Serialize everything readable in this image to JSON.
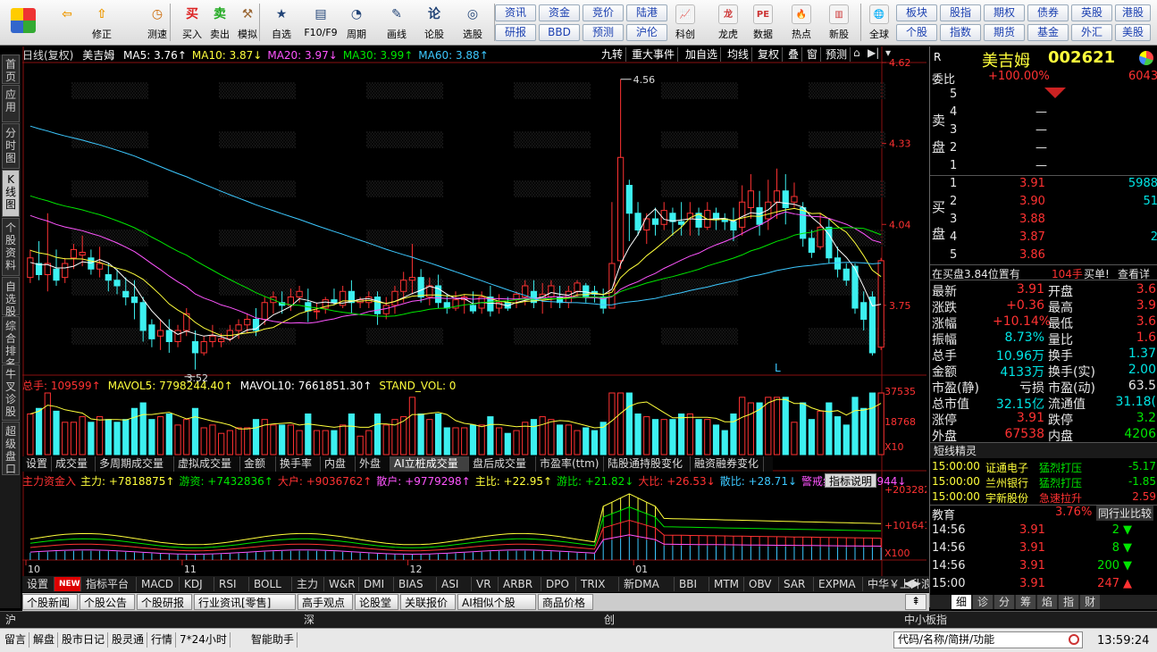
{
  "toolbar": {
    "left": [
      {
        "label": "",
        "icon": "grid-icon"
      },
      {
        "label": "",
        "icon": "back-arrow-icon"
      },
      {
        "label": "修正",
        "icon": "correct-icon"
      },
      {
        "label": "测速",
        "icon": "clock-icon"
      },
      {
        "label": "买入",
        "icon": "buy-icon"
      },
      {
        "label": "卖出",
        "icon": "sell-icon"
      },
      {
        "label": "模拟",
        "icon": "hammer-icon"
      },
      {
        "label": "自选",
        "icon": "star-icon"
      },
      {
        "label": "F10/F9",
        "icon": "f10-icon"
      },
      {
        "label": "周期",
        "icon": "period-icon"
      },
      {
        "label": "画线",
        "icon": "pen-icon"
      },
      {
        "label": "论股",
        "icon": "discuss-icon"
      },
      {
        "label": "选股",
        "icon": "select-stock-icon"
      }
    ],
    "mid_buttons": [
      [
        "资讯",
        "资金",
        "竞价",
        "陆港"
      ],
      [
        "研报",
        "BBD",
        "预测",
        "沪伦"
      ]
    ],
    "mid_icons": [
      {
        "label": "科创",
        "icon": "kechuang-icon"
      },
      {
        "label": "龙虎",
        "icon": "dragon-icon"
      },
      {
        "label": "数据",
        "icon": "pe-icon"
      },
      {
        "label": "热点",
        "icon": "hot-icon"
      },
      {
        "label": "新股",
        "icon": "newstock-icon"
      },
      {
        "label": "全球",
        "icon": "globe-icon"
      }
    ],
    "right_buttons": [
      [
        "板块",
        "股指",
        "期权",
        "债券",
        "英股",
        "港股"
      ],
      [
        "个股",
        "指数",
        "期货",
        "基金",
        "外汇",
        "美股"
      ]
    ]
  },
  "side_tabs": [
    "首页",
    "应用",
    "分时图",
    "K线图",
    "个股资料",
    "自选股",
    "综合排名",
    "牛叉诊股",
    "超级盘口"
  ],
  "chart_header": {
    "title": "日线(复权)",
    "name": "美吉姆",
    "ma": [
      {
        "label": "MA5: 3.76↑",
        "color": "#ffffff"
      },
      {
        "label": "MA10: 3.87↓",
        "color": "#ffff3c"
      },
      {
        "label": "MA20: 3.97↓",
        "color": "#ff55ff"
      },
      {
        "label": "MA30: 3.99↑",
        "color": "#00e600"
      },
      {
        "label": "MA60: 3.88↑",
        "color": "#3cc8ff"
      }
    ],
    "buttons": [
      "九转",
      "重大事件",
      "加自选",
      "均线",
      "复权",
      "叠",
      "窗",
      "预测"
    ]
  },
  "y_axis_main": [
    "4.62",
    "4.33",
    "4.04",
    "3.75"
  ],
  "annotations": {
    "high": "4.56",
    "low": "3.52",
    "marker": "L"
  },
  "vol_header": [
    {
      "label": "总手: 109599↑",
      "color": "#ff3232"
    },
    {
      "label": "MAVOL5: 7798244.40↑",
      "color": "#ffff3c"
    },
    {
      "label": "MAVOL10: 7661851.30↑",
      "color": "#ffffff"
    },
    {
      "label": "STAND_VOL: 0",
      "color": "#ffff3c"
    }
  ],
  "y_axis_vol": [
    "37535",
    "18768",
    "X10"
  ],
  "indicator_tabs": [
    "设置",
    "成交量",
    "多周期成交量",
    "虚拟成交量",
    "金额",
    "换手率",
    "内盘",
    "外盘",
    "AI立桩成交量",
    "盘后成交量",
    "市盈率(ttm)",
    "陆股通持股变化",
    "融资融券变化"
  ],
  "indicator_active": "AI立桩成交量",
  "fund_header": [
    {
      "label": "主力资金入",
      "color": "#ff3232"
    },
    {
      "label": "主力: +7818875↑",
      "color": "#ffff3c"
    },
    {
      "label": "游资: +7432836↑",
      "color": "#00e600"
    },
    {
      "label": "大户: +9036762↑",
      "color": "#ff3232"
    },
    {
      "label": "散户: +9779298↑",
      "color": "#ff55ff"
    },
    {
      "label": "主比: +22.95↑",
      "color": "#ffff3c"
    },
    {
      "label": "游比: +21.82↓",
      "color": "#00e600"
    },
    {
      "label": "大比: +26.53↓",
      "color": "#ff3232"
    },
    {
      "label": "散比: +28.71↓",
      "color": "#3cc8ff"
    },
    {
      "label": "警戒线: +5716944↓",
      "color": "#ff55ff"
    }
  ],
  "indicator_help": "指标说明",
  "y_axis_fund": [
    "+203282",
    "+101641",
    "X100"
  ],
  "x_axis": [
    "10",
    "11",
    "12",
    "01"
  ],
  "bottom_tabs": [
    "设置",
    "NEW",
    "指标平台",
    "MACD",
    "KDJ",
    "RSI",
    "BOLL",
    "主力",
    "W&R",
    "DMI",
    "BIAS",
    "ASI",
    "VR",
    "ARBR",
    "DPO",
    "TRIX",
    "新DMA",
    "BBI",
    "MTM",
    "OBV",
    "SAR",
    "EXPMA",
    "中华￥上升浪"
  ],
  "news_tabs": [
    "个股新闻",
    "个股公告",
    "个股研报",
    "行业资讯[零售]",
    "高手观点",
    "论股堂",
    "关联报价",
    "AI相似个股",
    "商品价格"
  ],
  "quote": {
    "tag": "R",
    "name": "美吉姆",
    "code": "002621",
    "weibi_label": "委比",
    "weibi": "+100.00%",
    "weicha": "6043",
    "sell_label": "卖盘",
    "buy_label": "买盘",
    "sell": [
      [
        "5",
        "",
        ""
      ],
      [
        "4",
        "—",
        ""
      ],
      [
        "3",
        "—",
        ""
      ],
      [
        "2",
        "—",
        ""
      ],
      [
        "1",
        "—",
        ""
      ]
    ],
    "buy": [
      [
        "1",
        "3.91",
        "5988"
      ],
      [
        "2",
        "3.90",
        "51"
      ],
      [
        "3",
        "3.88",
        ""
      ],
      [
        "4",
        "3.87",
        "2"
      ],
      [
        "5",
        "3.86",
        ""
      ]
    ],
    "bid_note": "在买盘3.84位置有",
    "bid_qty": "104手",
    "bid_type": "买单!",
    "bid_link": "查看详",
    "stats": [
      [
        "最新",
        "3.91",
        "red",
        "开盘",
        "3.6",
        "red"
      ],
      [
        "涨跌",
        "+0.36",
        "red",
        "最高",
        "3.9",
        "red"
      ],
      [
        "涨幅",
        "+10.14%",
        "red",
        "最低",
        "3.6",
        "red"
      ],
      [
        "振幅",
        "8.73%",
        "cyan",
        "量比",
        "1.6",
        "red"
      ],
      [
        "总手",
        "10.96万",
        "cyan",
        "换手",
        "1.37",
        "cyan"
      ],
      [
        "金额",
        "4133万",
        "cyan",
        "换手(实)",
        "2.00",
        "cyan"
      ],
      [
        "市盈(静)",
        "亏损",
        "wht",
        "市盈(动)",
        "63.5",
        "wht"
      ],
      [
        "总市值",
        "32.15亿",
        "cyan",
        "流通值",
        "31.18(",
        "cyan"
      ],
      [
        "涨停",
        "3.91",
        "red",
        "跌停",
        "3.2",
        "grn"
      ],
      [
        "外盘",
        "67538",
        "red",
        "内盘",
        "4206",
        "grn"
      ]
    ],
    "short_title": "短线精灵",
    "short": [
      [
        "15:00:00",
        "证通电子",
        "猛烈打压",
        "-5.17"
      ],
      [
        "15:00:00",
        "兰州银行",
        "猛烈打压",
        "-1.85"
      ],
      [
        "15:00:00",
        "宇新股份",
        "急速拉升",
        "2.59"
      ]
    ],
    "sector": "教育",
    "sector_pct": "3.76%",
    "sector_link": "同行业比较",
    "ticks": [
      [
        "14:56",
        "3.91",
        "2",
        "down"
      ],
      [
        "14:56",
        "3.91",
        "8",
        "down"
      ],
      [
        "14:56",
        "3.91",
        "200",
        "down"
      ],
      [
        "15:00",
        "3.91",
        "247",
        "up"
      ]
    ],
    "detail_tabs": [
      "细",
      "诊",
      "分",
      "筹",
      "焰",
      "指",
      "财"
    ]
  },
  "market": {
    "sh": "沪",
    "sz": "深",
    "cy": "创",
    "zx": "中小板指"
  },
  "status": {
    "items": [
      "留言",
      "解盘",
      "股市日记",
      "股灵通",
      "行情",
      "7*24小时",
      "智能助手"
    ],
    "search_placeholder": "代码/名称/简拼/功能",
    "time": "13:59:24"
  },
  "chart_data": {
    "type": "candlestick",
    "ylim": [
      3.5,
      4.62
    ],
    "candles": [
      [
        3.85,
        3.92,
        3.95,
        3.83
      ],
      [
        3.9,
        3.86,
        3.98,
        3.84
      ],
      [
        3.86,
        3.9,
        4.08,
        3.8
      ],
      [
        3.88,
        3.84,
        3.95,
        3.82
      ],
      [
        3.85,
        3.9,
        3.92,
        3.83
      ],
      [
        3.92,
        3.95,
        3.97,
        3.88
      ],
      [
        3.93,
        3.94,
        4.0,
        3.89
      ],
      [
        3.92,
        3.88,
        3.95,
        3.86
      ],
      [
        3.88,
        3.9,
        3.96,
        3.85
      ],
      [
        3.86,
        3.84,
        3.9,
        3.8
      ],
      [
        3.84,
        3.82,
        3.88,
        3.79
      ],
      [
        3.8,
        3.78,
        3.85,
        3.75
      ],
      [
        3.78,
        3.76,
        3.84,
        3.7
      ],
      [
        3.76,
        3.66,
        3.78,
        3.62
      ],
      [
        3.68,
        3.63,
        3.7,
        3.6
      ],
      [
        3.64,
        3.66,
        3.7,
        3.59
      ],
      [
        3.66,
        3.62,
        3.7,
        3.58
      ],
      [
        3.62,
        3.66,
        3.68,
        3.6
      ],
      [
        3.66,
        3.72,
        3.74,
        3.64
      ],
      [
        3.62,
        3.58,
        3.66,
        3.52
      ],
      [
        3.58,
        3.62,
        3.64,
        3.57
      ],
      [
        3.62,
        3.64,
        3.68,
        3.6
      ],
      [
        3.62,
        3.63,
        3.65,
        3.6
      ],
      [
        3.63,
        3.66,
        3.68,
        3.62
      ],
      [
        3.66,
        3.68,
        3.7,
        3.63
      ],
      [
        3.68,
        3.7,
        3.72,
        3.65
      ],
      [
        3.7,
        3.66,
        3.74,
        3.64
      ],
      [
        3.7,
        3.76,
        3.78,
        3.68
      ],
      [
        3.76,
        3.78,
        3.8,
        3.72
      ],
      [
        3.76,
        3.75,
        3.8,
        3.72
      ],
      [
        3.75,
        3.78,
        3.81,
        3.73
      ],
      [
        3.78,
        3.8,
        3.82,
        3.76
      ],
      [
        3.76,
        3.73,
        3.81,
        3.69
      ],
      [
        3.73,
        3.73,
        3.76,
        3.7
      ],
      [
        3.74,
        3.77,
        3.78,
        3.72
      ],
      [
        3.77,
        3.76,
        3.81,
        3.75
      ],
      [
        3.75,
        3.8,
        3.82,
        3.74
      ],
      [
        3.8,
        3.76,
        3.84,
        3.72
      ],
      [
        3.76,
        3.77,
        3.78,
        3.74
      ],
      [
        3.76,
        3.78,
        3.8,
        3.74
      ],
      [
        3.78,
        3.72,
        3.8,
        3.68
      ],
      [
        3.72,
        3.75,
        3.78,
        3.7
      ],
      [
        3.75,
        3.8,
        3.82,
        3.72
      ],
      [
        3.8,
        3.84,
        3.87,
        3.76
      ],
      [
        3.84,
        3.85,
        3.97,
        3.79
      ],
      [
        3.85,
        3.78,
        3.88,
        3.76
      ],
      [
        3.78,
        3.82,
        3.85,
        3.75
      ],
      [
        3.82,
        3.76,
        3.86,
        3.74
      ],
      [
        3.76,
        3.74,
        3.79,
        3.72
      ],
      [
        3.74,
        3.77,
        3.8,
        3.73
      ],
      [
        3.77,
        3.78,
        3.79,
        3.72
      ],
      [
        3.75,
        3.73,
        3.8,
        3.72
      ],
      [
        3.74,
        3.78,
        3.8,
        3.72
      ],
      [
        3.78,
        3.73,
        3.82,
        3.71
      ],
      [
        3.74,
        3.76,
        3.79,
        3.72
      ],
      [
        3.76,
        3.74,
        3.78,
        3.73
      ],
      [
        3.77,
        3.79,
        3.8,
        3.74
      ],
      [
        3.78,
        3.82,
        3.84,
        3.75
      ],
      [
        3.8,
        3.76,
        3.84,
        3.74
      ],
      [
        3.77,
        3.79,
        3.83,
        3.72
      ],
      [
        3.78,
        3.82,
        3.84,
        3.74
      ],
      [
        3.78,
        3.76,
        3.82,
        3.74
      ],
      [
        3.76,
        3.8,
        3.82,
        3.74
      ],
      [
        3.8,
        3.83,
        3.84,
        3.78
      ],
      [
        3.82,
        3.78,
        3.83,
        3.76
      ],
      [
        3.8,
        3.79,
        3.82,
        3.76
      ],
      [
        3.78,
        3.74,
        3.81,
        3.72
      ],
      [
        3.74,
        3.9,
        4.12,
        3.74
      ],
      [
        3.91,
        4.28,
        4.56,
        3.88
      ],
      [
        4.18,
        4.08,
        4.2,
        3.98
      ],
      [
        4.08,
        4.02,
        4.12,
        4.0
      ],
      [
        4.02,
        4.06,
        4.08,
        3.97
      ],
      [
        4.06,
        4.04,
        4.1,
        4.0
      ],
      [
        4.04,
        4.09,
        4.12,
        4.02
      ],
      [
        4.08,
        4.05,
        4.1,
        4.0
      ],
      [
        4.05,
        4.04,
        4.12,
        4.0
      ],
      [
        4.06,
        4.08,
        4.12,
        4.0
      ],
      [
        4.08,
        4.03,
        4.1,
        4.0
      ],
      [
        4.03,
        4.09,
        4.12,
        4.02
      ],
      [
        4.08,
        4.06,
        4.1,
        4.02
      ],
      [
        4.06,
        4.05,
        4.08,
        4.02
      ],
      [
        4.05,
        4.02,
        4.1,
        3.98
      ],
      [
        4.03,
        4.12,
        4.18,
        4.0
      ],
      [
        4.1,
        4.16,
        4.22,
        4.06
      ],
      [
        4.1,
        4.04,
        4.16,
        4.0
      ],
      [
        4.06,
        4.12,
        4.2,
        4.02
      ],
      [
        4.12,
        4.16,
        4.24,
        4.06
      ],
      [
        4.16,
        4.1,
        4.22,
        4.04
      ],
      [
        4.12,
        4.14,
        4.19,
        4.1
      ],
      [
        4.1,
        3.99,
        4.12,
        3.96
      ],
      [
        3.99,
        3.94,
        4.02,
        3.92
      ],
      [
        3.96,
        4.03,
        4.08,
        3.95
      ],
      [
        4.03,
        3.92,
        4.06,
        3.9
      ],
      [
        3.92,
        3.88,
        3.96,
        3.85
      ],
      [
        3.88,
        3.84,
        3.9,
        3.82
      ],
      [
        3.89,
        3.74,
        3.9,
        3.72
      ],
      [
        3.76,
        3.7,
        3.8,
        3.66
      ],
      [
        3.78,
        3.58,
        3.8,
        3.57
      ],
      [
        3.6,
        3.91,
        3.92,
        3.59
      ]
    ]
  }
}
